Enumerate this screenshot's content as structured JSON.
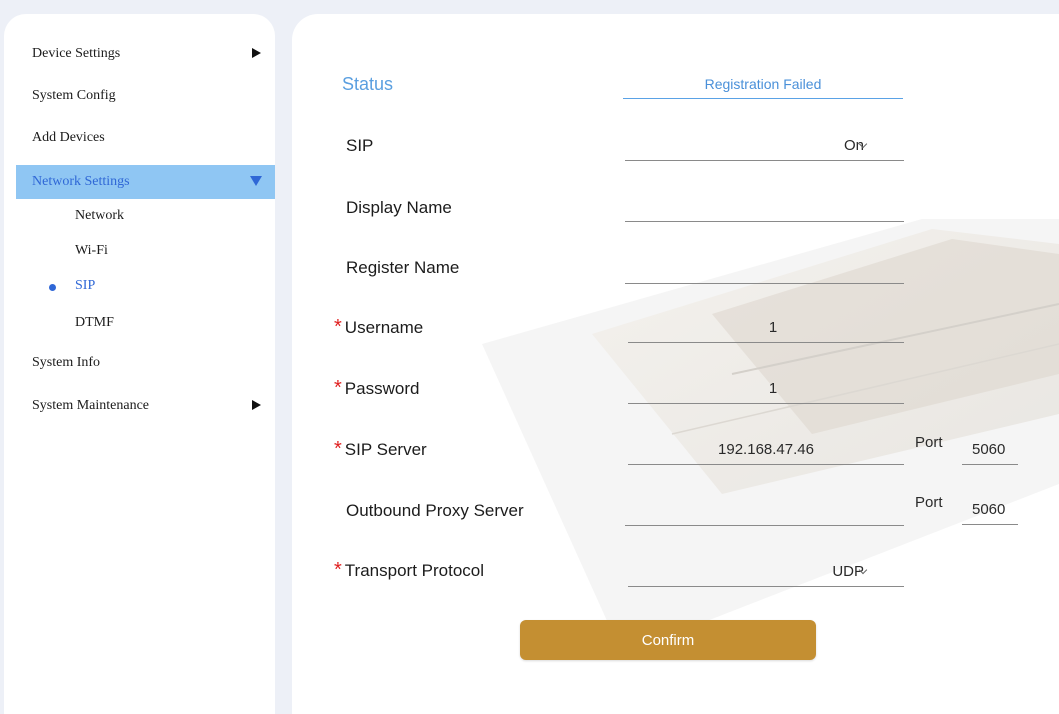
{
  "sidebar": {
    "items": [
      {
        "label": "Device Settings",
        "has_arrow": true
      },
      {
        "label": "System Config"
      },
      {
        "label": "Add Devices"
      },
      {
        "label": "Network Settings",
        "active": true
      },
      {
        "label": "System Info"
      },
      {
        "label": "System Maintenance",
        "has_arrow": true
      }
    ],
    "sub_items": [
      "Network",
      "Wi-Fi",
      "SIP",
      "DTMF"
    ],
    "current_sub": "SIP"
  },
  "form": {
    "status_label": "Status",
    "status_value": "Registration Failed",
    "sip_label": "SIP",
    "sip_value": "On",
    "display_name_label": "Display Name",
    "display_name_value": "",
    "register_name_label": "Register Name",
    "register_name_value": "",
    "username_label": "Username",
    "username_value": "1",
    "password_label": "Password",
    "password_value": "1",
    "sip_server_label": "SIP Server",
    "sip_server_value": "192.168.47.46",
    "sip_server_port_label": "Port",
    "sip_server_port_value": "5060",
    "outbound_proxy_label": "Outbound Proxy Server",
    "outbound_proxy_value": "",
    "outbound_proxy_port_label": "Port",
    "outbound_proxy_port_value": "5060",
    "transport_label": "Transport Protocol",
    "transport_value": "UDP",
    "required_marker": "*",
    "confirm_label": "Confirm"
  },
  "colors": {
    "accent_blue": "#5a9fe0",
    "active_nav_bg": "#8fc6f3",
    "confirm_bg": "#c48f32",
    "required": "#e02020"
  },
  "icons": [
    "chevron-right-icon",
    "chevron-down-icon",
    "bullet-icon",
    "select-chevron-icon"
  ]
}
